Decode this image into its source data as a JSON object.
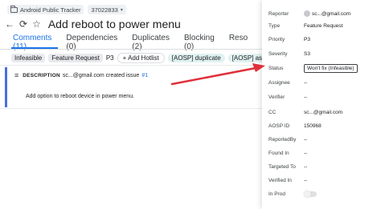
{
  "header": {
    "tracker_name": "Android Public Tracker",
    "issue_id": "37022833",
    "title": "Add reboot to power menu"
  },
  "tabs": [
    {
      "label": "Comments (11)"
    },
    {
      "label": "Dependencies (0)"
    },
    {
      "label": "Duplicates (2)"
    },
    {
      "label": "Blocking (0)"
    },
    {
      "label": "Reso"
    }
  ],
  "chips": {
    "status": "Infeasible",
    "type": "Feature Request",
    "priority": "P3",
    "add_hotlist": "+ Add Hotlist",
    "hotlist1": "[AOSP] duplicate",
    "hotlist2": "[AOSP] assigne"
  },
  "description": {
    "label": "DESCRIPTION",
    "author_text": "sc...@gmail.com created issue",
    "link": "#1",
    "body": "Add option to reboot device in power menu."
  },
  "fields": {
    "reporter": {
      "k": "Reporter",
      "v": "sc...@gmail.com"
    },
    "type": {
      "k": "Type",
      "v": "Feature Request"
    },
    "priority": {
      "k": "Priority",
      "v": "P3"
    },
    "severity": {
      "k": "Severity",
      "v": "S3"
    },
    "status": {
      "k": "Status",
      "v": "Won't fix (Infeasible)"
    },
    "assignee": {
      "k": "Assignee",
      "v": "--"
    },
    "verifier": {
      "k": "Verifier",
      "v": "--"
    },
    "cc": {
      "k": "CC",
      "v": "sc...@gmail.com"
    },
    "aosp_id": {
      "k": "AOSP ID",
      "v": "150968"
    },
    "reportedby": {
      "k": "ReportedBy",
      "v": "--"
    },
    "found_in": {
      "k": "Found In",
      "v": "--"
    },
    "targeted_to": {
      "k": "Targeted To",
      "v": "--"
    },
    "verified_in": {
      "k": "Verified In",
      "v": "--"
    },
    "in_prod": {
      "k": "In Prod",
      "v": ""
    }
  },
  "colors": {
    "accent": "#1a73e8",
    "arrow": "#e0303a"
  }
}
